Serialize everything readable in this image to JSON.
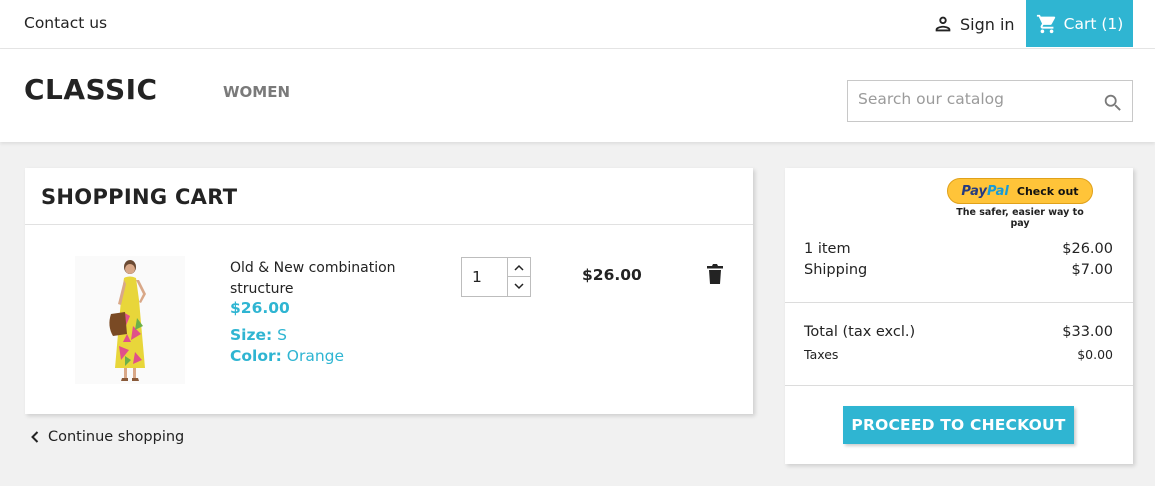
{
  "topnav": {
    "contact_label": "Contact us",
    "signin_label": "Sign in",
    "cart_label": "Cart (1)"
  },
  "header": {
    "logo": "CLASSIC",
    "menu_women": "WOMEN",
    "search_placeholder": "Search our catalog"
  },
  "cart": {
    "title": "SHOPPING CART",
    "item": {
      "name": "Old & New combination structure",
      "price": "$26.00",
      "size_label": "Size:",
      "size_value": "S",
      "color_label": "Color:",
      "color_value": "Orange",
      "quantity": "1",
      "line_total": "$26.00"
    },
    "continue_label": "Continue shopping"
  },
  "summary": {
    "paypal_word_1": "Pay",
    "paypal_word_2": "Pal",
    "paypal_checkout": "Check out",
    "paypal_tagline": "The safer, easier way to pay",
    "items_label": "1 item",
    "items_value": "$26.00",
    "shipping_label": "Shipping",
    "shipping_value": "$7.00",
    "total_label": "Total (tax excl.)",
    "total_value": "$33.00",
    "taxes_label": "Taxes",
    "taxes_value": "$0.00",
    "checkout_label": "PROCEED TO CHECKOUT"
  },
  "colors": {
    "accent": "#2fb5d2",
    "paypal_yellow": "#ffc439"
  },
  "icons": [
    "person-icon",
    "cart-icon",
    "search-icon",
    "trash-icon",
    "chevron-left-icon",
    "chevron-up-icon",
    "chevron-down-icon"
  ]
}
